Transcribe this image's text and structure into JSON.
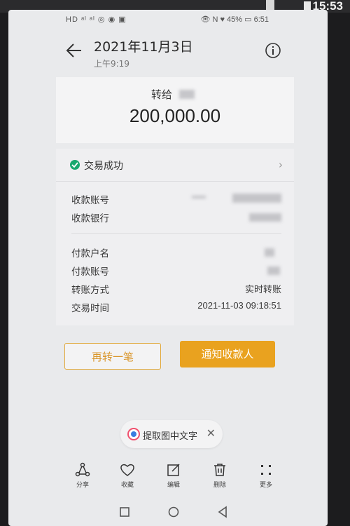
{
  "outer": {
    "time": "15:53"
  },
  "status_bar": {
    "left_icons": "HD ᵃᴵ ᵃᴵ ◎ ◉ ▣",
    "right": "👁 N ♥ 45% ▭ 6:51"
  },
  "header": {
    "date": "2021年11月3日",
    "time": "上午9:19"
  },
  "transfer": {
    "to_label": "转给",
    "amount": "200,000.00"
  },
  "status": {
    "text": "交易成功"
  },
  "details": {
    "payee_account_label": "收款账号",
    "payee_bank_label": "收款银行",
    "payer_name_label": "付款户名",
    "payer_account_label": "付款账号",
    "method_label": "转账方式",
    "method_value": "实时转账",
    "time_label": "交易时间",
    "time_value": "2021-11-03 09:18:51"
  },
  "buttons": {
    "transfer_again": "再转一笔",
    "notify_payee": "通知收款人"
  },
  "ocr_chip": {
    "label": "提取图中文字"
  },
  "toolbar": {
    "share": "分享",
    "favorite": "收藏",
    "edit": "编辑",
    "delete": "删除",
    "more": "更多"
  },
  "colors": {
    "accent": "#e9a21f",
    "success": "#19a86e"
  }
}
